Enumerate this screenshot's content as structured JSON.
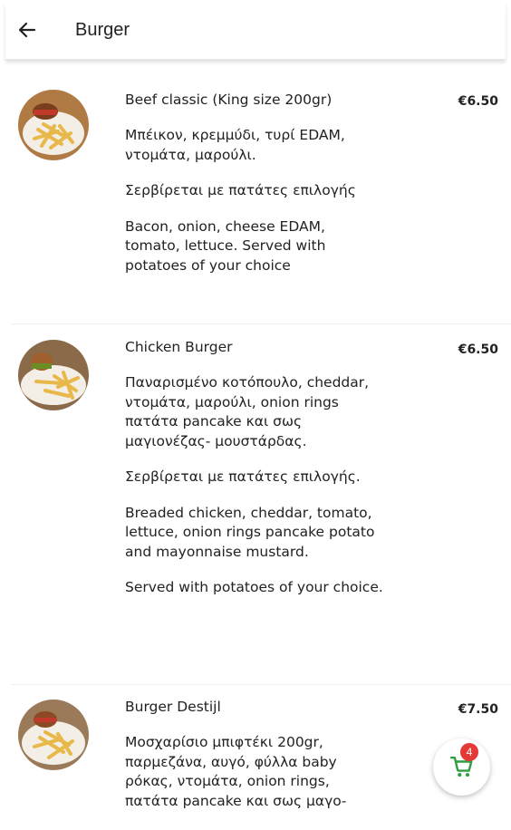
{
  "header": {
    "title": "Burger",
    "back_icon": "arrow-left-icon"
  },
  "items": [
    {
      "name": "Beef classic (King size 200gr)",
      "price": "€6.50",
      "description": [
        "Μπέικον, κρεμμύδι, τυρί EDAM, ντομάτα, μαρούλι.",
        "Σερβίρεται με πατάτες επιλογής",
        "Bacon, onion, cheese EDAM, tomato, lettuce. Served with potatoes of your choice"
      ]
    },
    {
      "name": "Chicken Burger",
      "price": "€6.50",
      "description": [
        "Παναρισμένο κοτόπουλο, cheddar, ντομάτα, μαρούλι, onion rings πατάτα pancake και σως μαγιονέζας- μουστάρδας.",
        "Σερβίρεται με πατάτες επιλογής.",
        "Breaded chicken, cheddar, tomato, lettuce, onion rings pancake potato and mayonnaise mustard.",
        "Served with potatoes of your choice."
      ]
    },
    {
      "name": "Burger Destijl",
      "price": "€7.50",
      "description": [
        "Μοσχαρίσιο μπιφτέκι 200gr, παρμεζάνα, αυγό, φύλλα baby ρόκας, ντομάτα, onion rings, πατάτα pancake και σως μαγο-"
      ]
    }
  ],
  "cart": {
    "count": "4",
    "icon": "shopping-cart-icon",
    "accent_color": "#2e9e3e",
    "badge_color": "#e53935"
  }
}
